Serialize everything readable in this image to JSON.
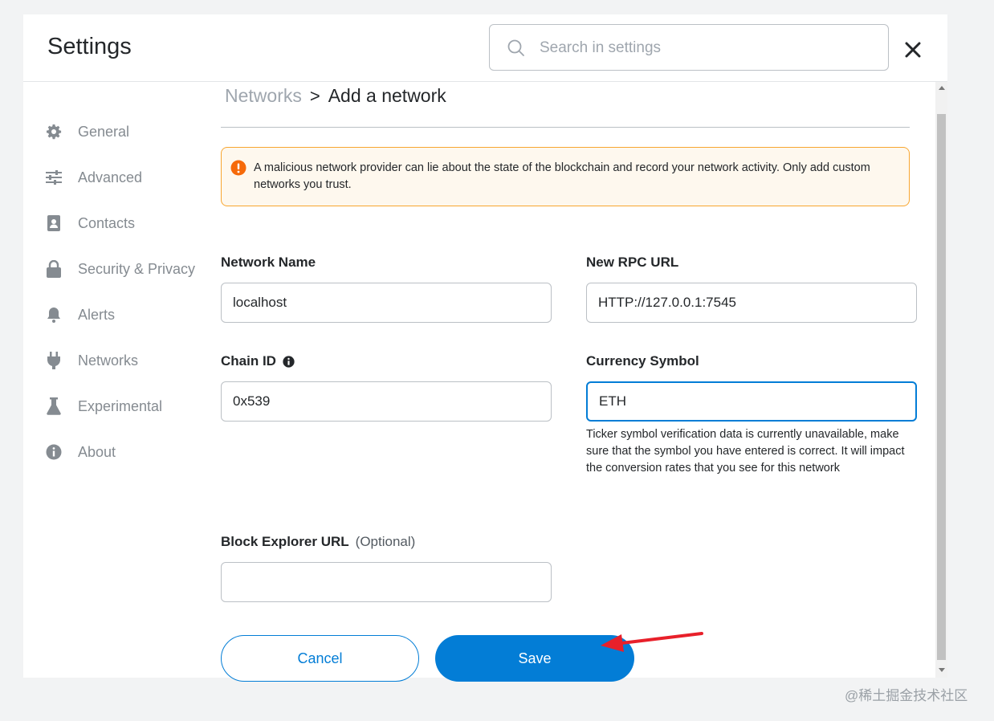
{
  "header": {
    "title": "Settings",
    "search_placeholder": "Search in settings"
  },
  "sidebar": {
    "items": [
      {
        "label": "General",
        "icon": "gear-icon"
      },
      {
        "label": "Advanced",
        "icon": "sliders-icon"
      },
      {
        "label": "Contacts",
        "icon": "contacts-book-icon"
      },
      {
        "label": "Security & Privacy",
        "icon": "lock-icon"
      },
      {
        "label": "Alerts",
        "icon": "bell-icon"
      },
      {
        "label": "Networks",
        "icon": "plug-icon"
      },
      {
        "label": "Experimental",
        "icon": "flask-icon"
      },
      {
        "label": "About",
        "icon": "info-icon"
      }
    ]
  },
  "breadcrumb": {
    "root": "Networks",
    "separator": ">",
    "current": "Add a network"
  },
  "warning": {
    "text": "A malicious network provider can lie about the state of the blockchain and record your network activity. Only add custom networks you trust.",
    "icon": "exclamation-icon",
    "color": "#f8a630"
  },
  "form": {
    "network_name": {
      "label": "Network Name",
      "value": "localhost"
    },
    "rpc_url": {
      "label": "New RPC URL",
      "value": "HTTP://127.0.0.1:7545"
    },
    "chain_id": {
      "label": "Chain ID",
      "value": "0x539"
    },
    "currency_symbol": {
      "label": "Currency Symbol",
      "value": "ETH",
      "help": "Ticker symbol verification data is currently unavailable, make sure that the symbol you have entered is correct. It will impact the conversion rates that you see for this network"
    },
    "block_explorer": {
      "label": "Block Explorer URL",
      "optional": "(Optional)",
      "value": ""
    }
  },
  "buttons": {
    "cancel": "Cancel",
    "save": "Save"
  },
  "colors": {
    "accent": "#037dd6",
    "annotation_arrow": "#e8202a"
  },
  "watermark": "@稀土掘金技术社区"
}
